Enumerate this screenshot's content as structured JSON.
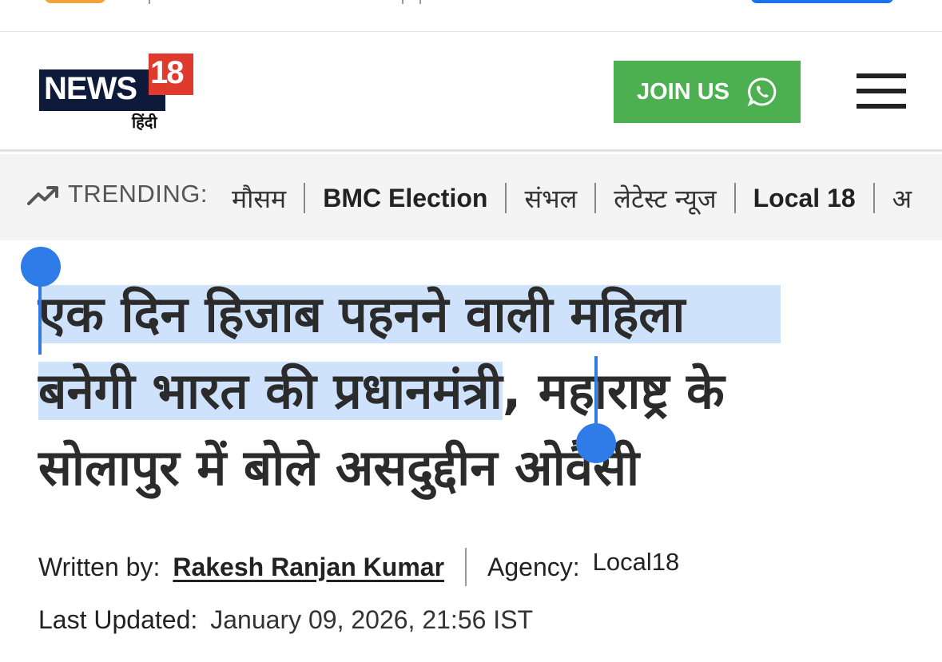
{
  "header": {
    "logo_brand": "NEWS",
    "logo_number": "18",
    "logo_language": "हिंदी",
    "join_label": "JOIN US",
    "join_icon": "whatsapp-icon",
    "menu_icon": "hamburger-menu-icon",
    "brand_color": "#e03a2f",
    "join_color": "#4caf50"
  },
  "trending": {
    "label": "TRENDING:",
    "icon": "trending-up-icon",
    "items": [
      "मौसम",
      "BMC Election",
      "संभल",
      "लेटेस्ट न्यूज",
      "Local 18",
      "अ"
    ]
  },
  "article": {
    "headline_selected_line1": "एक दिन हिजाब पहनने वाली महिला",
    "headline_selected_line2": "बनेगी भारत की प्रधानमंत्री",
    "headline_rest_line2": ", महाराष्ट्र के",
    "headline_line3": "सोलापुर में बोले असदुद्दीन ओवैसी",
    "selection_color": "#cfe2fb",
    "written_by_label": "Written by:",
    "author": "Rakesh Ranjan Kumar",
    "agency_label": "Agency:",
    "agency": "Local18",
    "updated_label": "Last Updated:",
    "updated_value": "January 09, 2026, 21:56 IST"
  }
}
